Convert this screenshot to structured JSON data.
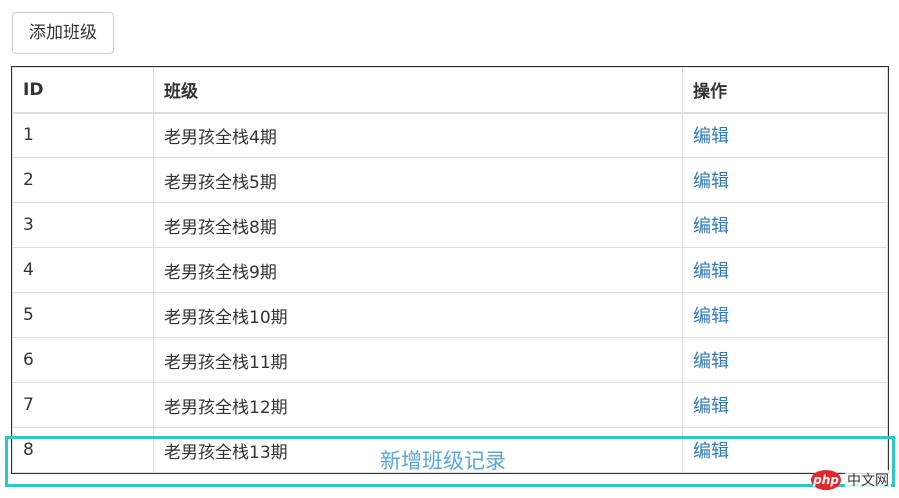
{
  "toolbar": {
    "add_class_label": "添加班级"
  },
  "table": {
    "headers": {
      "id": "ID",
      "class": "班级",
      "action": "操作"
    },
    "rows": [
      {
        "id": "1",
        "name": "老男孩全栈4期",
        "action": "编辑"
      },
      {
        "id": "2",
        "name": "老男孩全栈5期",
        "action": "编辑"
      },
      {
        "id": "3",
        "name": "老男孩全栈8期",
        "action": "编辑"
      },
      {
        "id": "4",
        "name": "老男孩全栈9期",
        "action": "编辑"
      },
      {
        "id": "5",
        "name": "老男孩全栈10期",
        "action": "编辑"
      },
      {
        "id": "6",
        "name": "老男孩全栈11期",
        "action": "编辑"
      },
      {
        "id": "7",
        "name": "老男孩全栈12期",
        "action": "编辑"
      },
      {
        "id": "8",
        "name": "老男孩全栈13期",
        "action": "编辑"
      }
    ]
  },
  "annotation": {
    "text": "新增班级记录",
    "color": "#5aa7de",
    "box_color": "#2fc6c6"
  },
  "watermark": {
    "logo": "php",
    "text": "中文网"
  },
  "colors": {
    "link": "#337ab7"
  }
}
